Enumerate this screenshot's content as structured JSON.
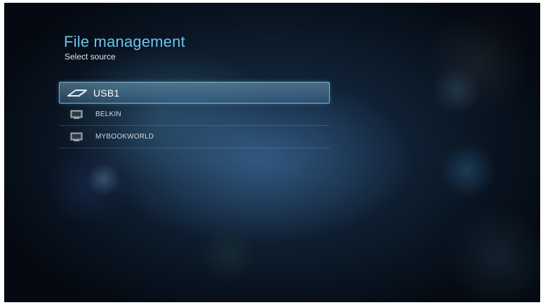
{
  "header": {
    "title": "File management",
    "subtitle": "Select source"
  },
  "sources": [
    {
      "label": "USB1",
      "icon": "usb-drive-icon",
      "selected": true
    },
    {
      "label": "BELKIN",
      "icon": "network-computer-icon",
      "selected": false
    },
    {
      "label": "MYBOOKWORLD",
      "icon": "network-computer-icon",
      "selected": false
    }
  ],
  "colors": {
    "title": "#6ec3ea",
    "highlight": "#5a9ccb",
    "background": "#0a1624"
  }
}
